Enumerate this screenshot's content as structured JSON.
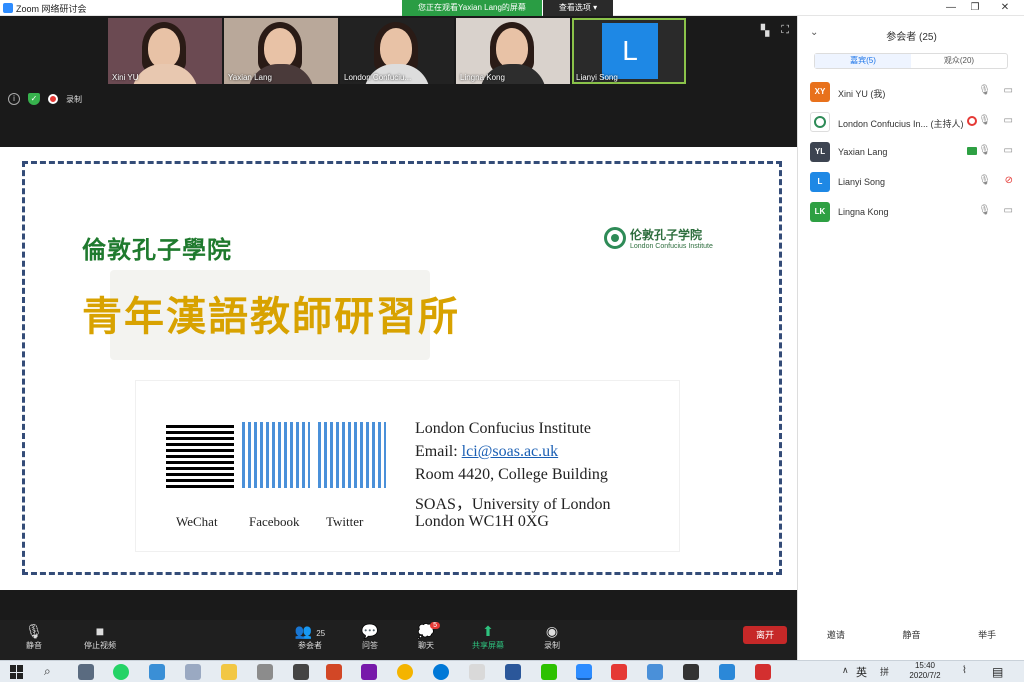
{
  "window": {
    "title": "Zoom 网络研讨会",
    "controls": {
      "minimize": "—",
      "restore": "❐",
      "close": "✕"
    }
  },
  "banner": {
    "viewing_text": "您正在观看Yaxian Lang的屏幕",
    "view_options": "查看选项 ▾"
  },
  "thumbnails": [
    {
      "name": "Xini YU"
    },
    {
      "name": "Yaxian Lang"
    },
    {
      "name": "London Confuciu..."
    },
    {
      "name": "Lingna Kong"
    },
    {
      "name": "Lianyi Song",
      "avatar_letter": "L"
    }
  ],
  "info_row": {
    "record_label": "录制"
  },
  "top_right_icons": {
    "view": "▚",
    "fullscreen": "⛶"
  },
  "slide": {
    "title_small": "倫敦孔子學院",
    "title_large": "青年漢語教師研習所",
    "logo_cn": "伦敦孔子学院",
    "logo_en": "London Confucius Institute",
    "qr_labels": [
      "WeChat",
      "Facebook",
      "Twitter"
    ],
    "address": {
      "line1": "London Confucius Institute",
      "email_label": "Email: ",
      "email": "lci@soas.ac.uk",
      "line3": "Room 4420, College Building",
      "line4": "SOAS，University of London",
      "line5": "London WC1H 0XG"
    }
  },
  "toolbar": {
    "mute": "静音",
    "stop_video": "停止视频",
    "participants": "参会者",
    "participants_count": "25",
    "qa": "问答",
    "chat": "聊天",
    "chat_badge": "5",
    "share": "共享屏幕",
    "record": "录制",
    "leave": "离开"
  },
  "panel": {
    "title": "参会者 (25)",
    "tabs": [
      "嘉宾(5)",
      "观众(20)"
    ],
    "participants": [
      {
        "initials": "XY",
        "name": "Xini YU (我)",
        "color": "#e8711c"
      },
      {
        "initials": "",
        "name": "London Confucius In... (主持人)",
        "color": "#ffffff"
      },
      {
        "initials": "YL",
        "name": "Yaxian Lang",
        "color": "#3d4451"
      },
      {
        "initials": "L",
        "name": "Lianyi Song",
        "color": "#1e88e5"
      },
      {
        "initials": "LK",
        "name": "Lingna Kong",
        "color": "#2ea043"
      }
    ],
    "actions": [
      "邀请",
      "静音",
      "举手"
    ]
  },
  "taskbar": {
    "lang": "英",
    "ime": "拼",
    "time": "15:40",
    "date": "2020/7/2"
  }
}
